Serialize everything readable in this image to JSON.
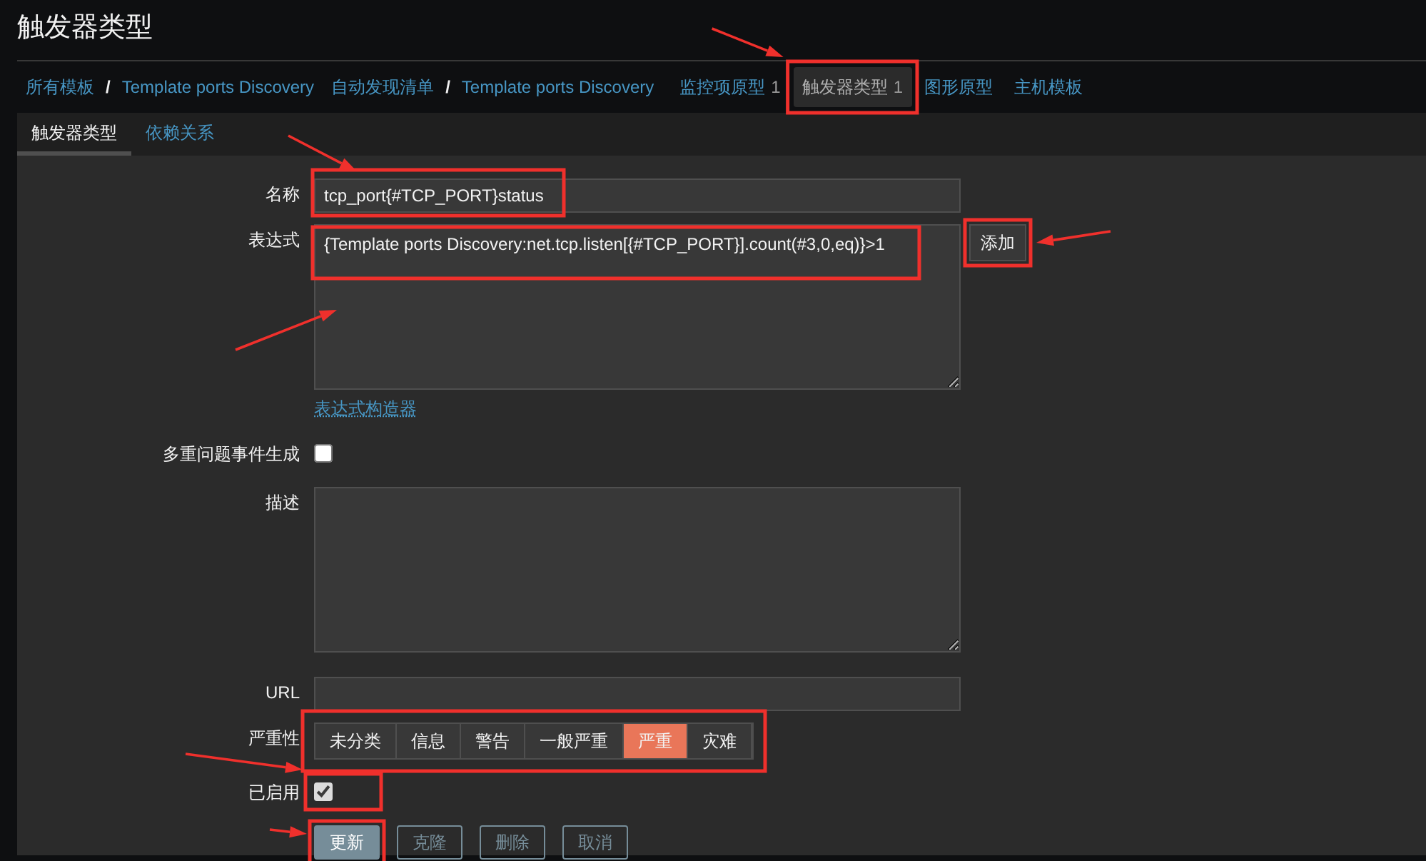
{
  "header": {
    "title": "触发器类型"
  },
  "breadcrumbs": [
    {
      "items": [
        "所有模板",
        "Template ports Discovery"
      ],
      "separator": "/"
    },
    {
      "items": [
        "自动发现清单",
        "Template ports Discovery"
      ],
      "separator": "/"
    }
  ],
  "nav_tabs": [
    {
      "label": "监控项原型",
      "count": "1",
      "selected": false
    },
    {
      "label": "触发器类型",
      "count": "1",
      "selected": true
    },
    {
      "label": "图形原型",
      "selected": false
    },
    {
      "label": "主机模板",
      "selected": false
    }
  ],
  "sub_tabs": [
    {
      "label": "触发器类型",
      "selected": true
    },
    {
      "label": "依赖关系",
      "selected": false
    }
  ],
  "form": {
    "name": {
      "label": "名称",
      "value": "tcp_port{#TCP_PORT}status"
    },
    "expression": {
      "label": "表达式",
      "value": "{Template ports Discovery:net.tcp.listen[{#TCP_PORT}].count(#3,0,eq)}>1",
      "add_button": "添加",
      "builder_link": "表达式构造器"
    },
    "multiple_events": {
      "label": "多重问题事件生成",
      "checked": false
    },
    "description": {
      "label": "描述"
    },
    "url": {
      "label": "URL"
    },
    "severity": {
      "label": "严重性",
      "options": [
        {
          "label": "未分类",
          "selected": false
        },
        {
          "label": "信息",
          "selected": false
        },
        {
          "label": "警告",
          "selected": false
        },
        {
          "label": "一般严重",
          "selected": false
        },
        {
          "label": "严重",
          "selected": true
        },
        {
          "label": "灾难",
          "selected": false
        }
      ]
    },
    "enabled": {
      "label": "已启用",
      "checked": true
    },
    "buttons": [
      {
        "label": "更新",
        "kind": "primary"
      },
      {
        "label": "克隆",
        "kind": "secondary"
      },
      {
        "label": "删除",
        "kind": "secondary"
      },
      {
        "label": "取消",
        "kind": "secondary"
      }
    ]
  }
}
